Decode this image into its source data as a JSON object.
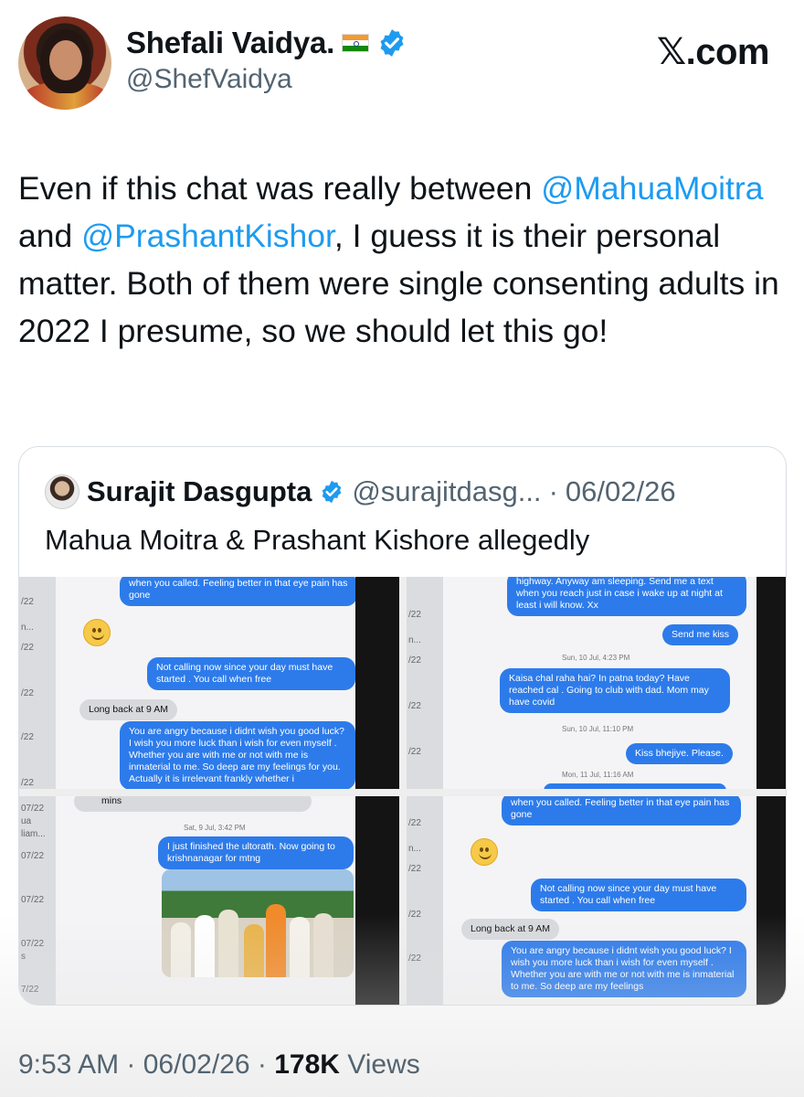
{
  "author": {
    "name": "Shefali Vaidya.",
    "handle": "@ShefVaidya",
    "flag_icon": "india-flag-icon",
    "verified_icon": "verified-badge-icon"
  },
  "brand": {
    "site": "𝕏.com"
  },
  "tweet": {
    "part1": "Even if this chat was really between ",
    "mention1": "@MahuaMoitra",
    "part2": " and ",
    "mention2": "@PrashantKishor",
    "part3": ", I guess it is their personal matter. Both of them were single consenting adults in 2022 I presume, so we should let this go!"
  },
  "quote": {
    "name": "Surajit Dasgupta",
    "handle": "@surajitdasg...",
    "separator": "·",
    "date": "06/02/26",
    "text": "Mahua Moitra & Prashant Kishore allegedly",
    "panels": {
      "p1": {
        "side": [
          "/22",
          "n...",
          "/22",
          "/22",
          "/22",
          "/22"
        ],
        "b1": "when you called. Feeling better in that eye pain has gone",
        "b2": "Not calling now since your day must have started . You call when free",
        "g1": "Long back at 9 AM",
        "b3": "You are angry because i didnt wish you good luck? I wish you more luck than i wish for even myself . Whether you are with me or not with me is inmaterial to me. So deep are my feelings for you. Actually it is irrelevant frankly whether i"
      },
      "p2": {
        "side": [
          "/22",
          "n...",
          "/22",
          "/22",
          "/22"
        ],
        "b1": "highway. Anyway am sleeping. Send me a text when you reach just in case i wake up at night at least i will know. Xx",
        "b2": "Send me kiss",
        "t1": "Sun, 10 Jul, 4:23 PM",
        "b3": "Kaisa chal raha hai? In patna today? Have reached cal . Going to club with dad. Mom may have covid",
        "t2": "Sun, 10 Jul, 11:10 PM",
        "b4": "Kiss bhejiye. Please.",
        "t3": "Mon, 11 Jul, 11:16 AM"
      },
      "p3": {
        "side": [
          "07/22",
          "ua",
          "liam...",
          "07/22",
          "07/22",
          "07/22",
          "s",
          "7/22"
        ],
        "g1": "mins",
        "t1": "Sat, 9 Jul, 3:42 PM",
        "b1": "I just finished the ultorath. Now going to krishnanagar for mtng"
      },
      "p4": {
        "side": [
          "/22",
          "n...",
          "/22",
          "/22",
          "/22"
        ],
        "b1": "when you called. Feeling better in that eye pain has gone",
        "b2": "Not calling now since your day must have started . You call when free",
        "g1": "Long back at 9 AM",
        "b3": "You are angry because i didnt wish you good luck? I wish you more luck than i wish for even myself . Whether you are with me or not with me is inmaterial to me. So deep are my feelings"
      }
    }
  },
  "meta": {
    "time": "9:53 AM",
    "separator": " · ",
    "date": "06/02/26",
    "views_count": "178K",
    "views_label": " Views"
  },
  "colors": {
    "link": "#1d9bf0",
    "muted": "#536471",
    "bubble_blue": "#2d7bea"
  }
}
